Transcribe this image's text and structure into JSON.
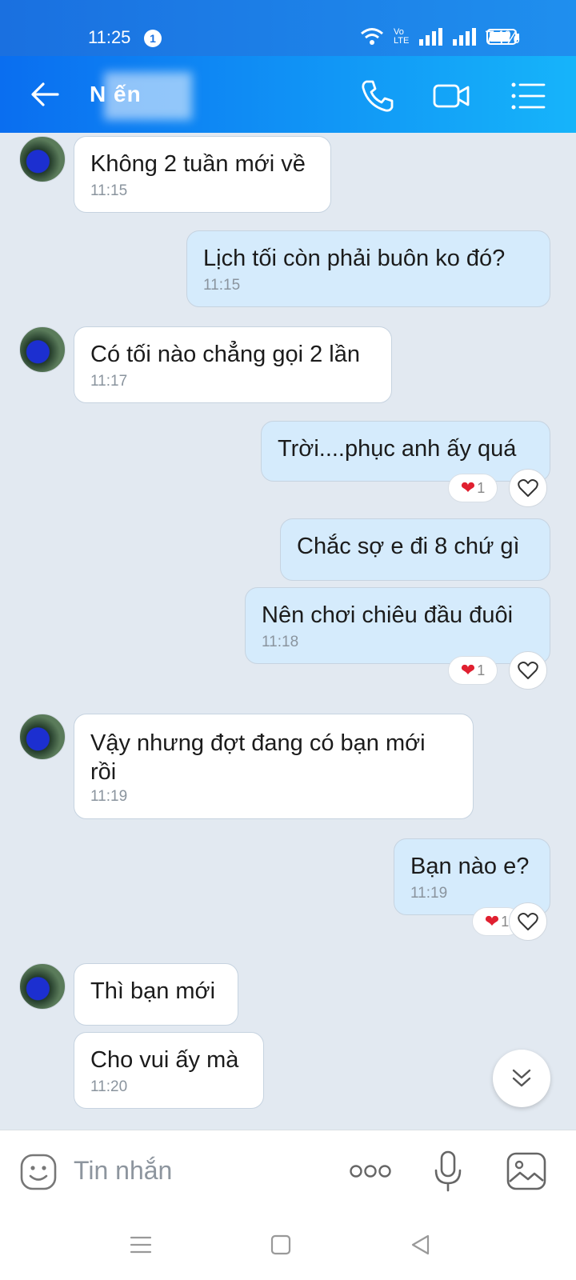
{
  "status_bar": {
    "time": "11:25",
    "notification_count": "1",
    "network": "Vo LTE",
    "battery": "74%"
  },
  "header": {
    "contact_name": "N        ến"
  },
  "messages": [
    {
      "dir": "in",
      "text": "Không 2 tuần mới về",
      "time": "11:15"
    },
    {
      "dir": "out",
      "text": "Lịch tối còn phải buôn ko đó?",
      "time": "11:15"
    },
    {
      "dir": "in",
      "text": "Có tối nào chẳng gọi 2 lần",
      "time": "11:17"
    },
    {
      "dir": "out",
      "text": "Trời....phục anh ấy quá",
      "time": "",
      "reaction_count": "1"
    },
    {
      "dir": "out",
      "text": "Chắc sợ e đi 8 chứ gì",
      "time": ""
    },
    {
      "dir": "out",
      "text": "Nên chơi chiêu đầu đuôi",
      "time": "11:18",
      "reaction_count": "1"
    },
    {
      "dir": "in",
      "text": "Vậy nhưng đợt đang có bạn mới rồi",
      "time": "11:19"
    },
    {
      "dir": "out",
      "text": "Bạn nào e?",
      "time": "11:19",
      "reaction_count": "1"
    },
    {
      "dir": "in",
      "text": "Thì bạn mới",
      "time": ""
    },
    {
      "dir": "in",
      "text": "Cho vui ấy mà",
      "time": "11:20"
    }
  ],
  "composer": {
    "placeholder": "Tin nhắn"
  },
  "colors": {
    "header": "#1296f5",
    "incoming": "#ffffff",
    "outgoing": "#d5ebfc",
    "background": "#e2e9f1"
  },
  "icons": [
    "back-arrow-icon",
    "phone-icon",
    "video-call-icon",
    "menu-list-icon",
    "emoji-icon",
    "more-dots-icon",
    "microphone-icon",
    "image-icon",
    "scroll-down-icon",
    "heart-icon"
  ]
}
